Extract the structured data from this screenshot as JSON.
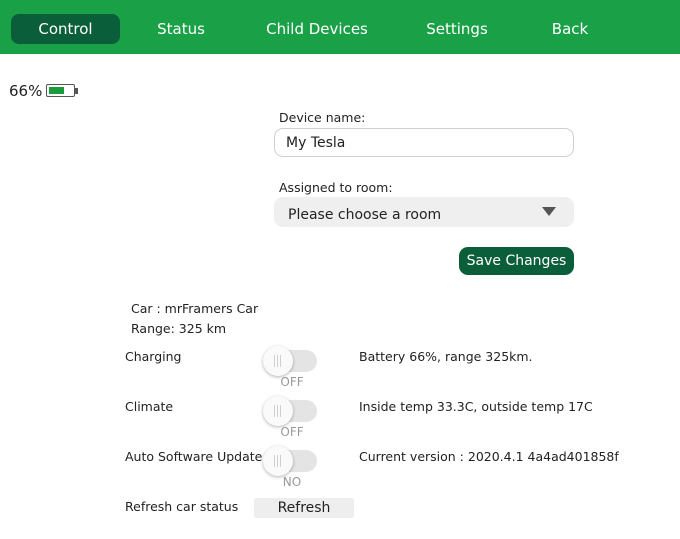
{
  "nav": {
    "tabs": [
      "Control",
      "Status",
      "Child Devices",
      "Settings",
      "Back"
    ],
    "active": "Control"
  },
  "battery": {
    "percent_label": "66%",
    "level": 0.66
  },
  "form": {
    "device_name_label": "Device name:",
    "device_name_value": "My Tesla",
    "room_label": "Assigned to room:",
    "room_value": "Please choose a room",
    "save_label": "Save Changes"
  },
  "car": {
    "name_line": "Car : mrFramers Car",
    "range_line": "Range: 325 km"
  },
  "controls": [
    {
      "label": "Charging",
      "state": "OFF",
      "info": "Battery 66%, range 325km."
    },
    {
      "label": "Climate",
      "state": "OFF",
      "info": "Inside temp 33.3C, outside temp 17C"
    },
    {
      "label": "Auto Software Update",
      "state": "NO",
      "info": "Current version : 2020.4.1 4a4ad401858f"
    }
  ],
  "refresh": {
    "label": "Refresh car status",
    "button_label": "Refresh"
  },
  "colors": {
    "nav_bg": "#1aa148",
    "accent": "#0b5e3a",
    "battery_fill": "#1a9c3b"
  }
}
